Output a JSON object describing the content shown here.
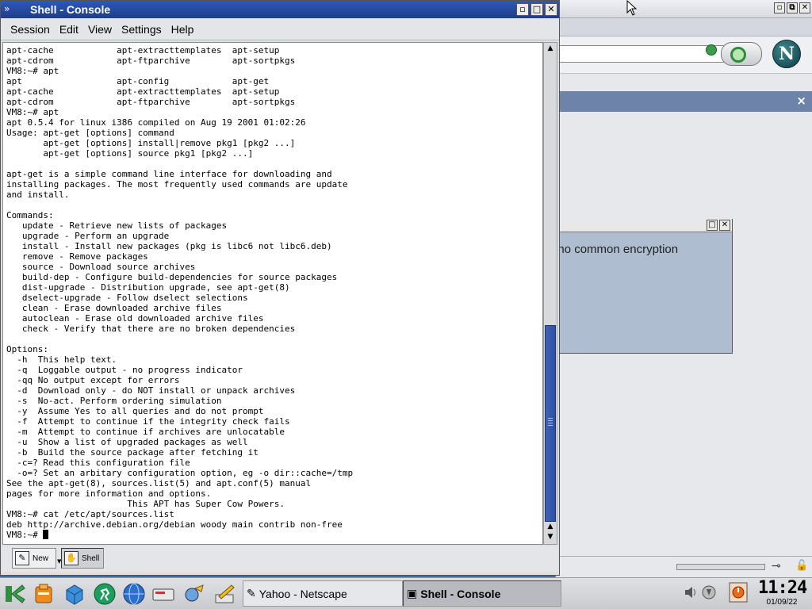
{
  "konsole": {
    "title": "Shell - Console",
    "title_icon": "»",
    "menu": [
      "Session",
      "Edit",
      "View",
      "Settings",
      "Help"
    ],
    "terminal_lines": [
      "apt-cache            apt-extracttemplates  apt-setup",
      "apt-cdrom            apt-ftparchive        apt-sortpkgs",
      "VM8:~# apt",
      "apt                  apt-config            apt-get",
      "apt-cache            apt-extracttemplates  apt-setup",
      "apt-cdrom            apt-ftparchive        apt-sortpkgs",
      "VM8:~# apt",
      "apt 0.5.4 for linux i386 compiled on Aug 19 2001 01:02:26",
      "Usage: apt-get [options] command",
      "       apt-get [options] install|remove pkg1 [pkg2 ...]",
      "       apt-get [options] source pkg1 [pkg2 ...]",
      "",
      "apt-get is a simple command line interface for downloading and",
      "installing packages. The most frequently used commands are update",
      "and install.",
      "",
      "Commands:",
      "   update - Retrieve new lists of packages",
      "   upgrade - Perform an upgrade",
      "   install - Install new packages (pkg is libc6 not libc6.deb)",
      "   remove - Remove packages",
      "   source - Download source archives",
      "   build-dep - Configure build-dependencies for source packages",
      "   dist-upgrade - Distribution upgrade, see apt-get(8)",
      "   dselect-upgrade - Follow dselect selections",
      "   clean - Erase downloaded archive files",
      "   autoclean - Erase old downloaded archive files",
      "   check - Verify that there are no broken dependencies",
      "",
      "Options:",
      "  -h  This help text.",
      "  -q  Loggable output - no progress indicator",
      "  -qq No output except for errors",
      "  -d  Download only - do NOT install or unpack archives",
      "  -s  No-act. Perform ordering simulation",
      "  -y  Assume Yes to all queries and do not prompt",
      "  -f  Attempt to continue if the integrity check fails",
      "  -m  Attempt to continue if archives are unlocatable",
      "  -u  Show a list of upgraded packages as well",
      "  -b  Build the source package after fetching it",
      "  -c=? Read this configuration file",
      "  -o=? Set an arbitary configuration option, eg -o dir::cache=/tmp",
      "See the apt-get(8), sources.list(5) and apt.conf(5) manual",
      "pages for more information and options.",
      "                       This APT has Super Cow Powers.",
      "VM8:~# cat /etc/apt/sources.list",
      "deb http://archive.debian.org/debian woody main contrib non-free"
    ],
    "prompt": "VM8:~# ",
    "tabs": [
      {
        "label": "New",
        "icon": "new-session-icon"
      },
      {
        "label": "Shell",
        "icon": "shell-icon"
      }
    ]
  },
  "background": {
    "logo_letter": "N",
    "sidebar_close": "×",
    "dialog_text": "ave no common encryption"
  },
  "taskbar": {
    "launchers": [
      "kde-menu-icon",
      "lifesaver-help-icon",
      "home-cube-icon",
      "runner-icon",
      "globe-browser-icon",
      "drive-icon",
      "tools-icon",
      "pen-edit-icon"
    ],
    "tasks": [
      {
        "label": "Yahoo - Netscape",
        "state": "inactive"
      },
      {
        "label": "Shell - Console",
        "state": "active"
      }
    ],
    "clock_time": "11:24",
    "clock_date": "01/09/22"
  },
  "colors": {
    "titlebar_active": "#2f59b8",
    "sidebar_bar": "#6d84a8",
    "dialog_bg": "#aebdd0",
    "scroll_thumb": "#3f63b8"
  }
}
